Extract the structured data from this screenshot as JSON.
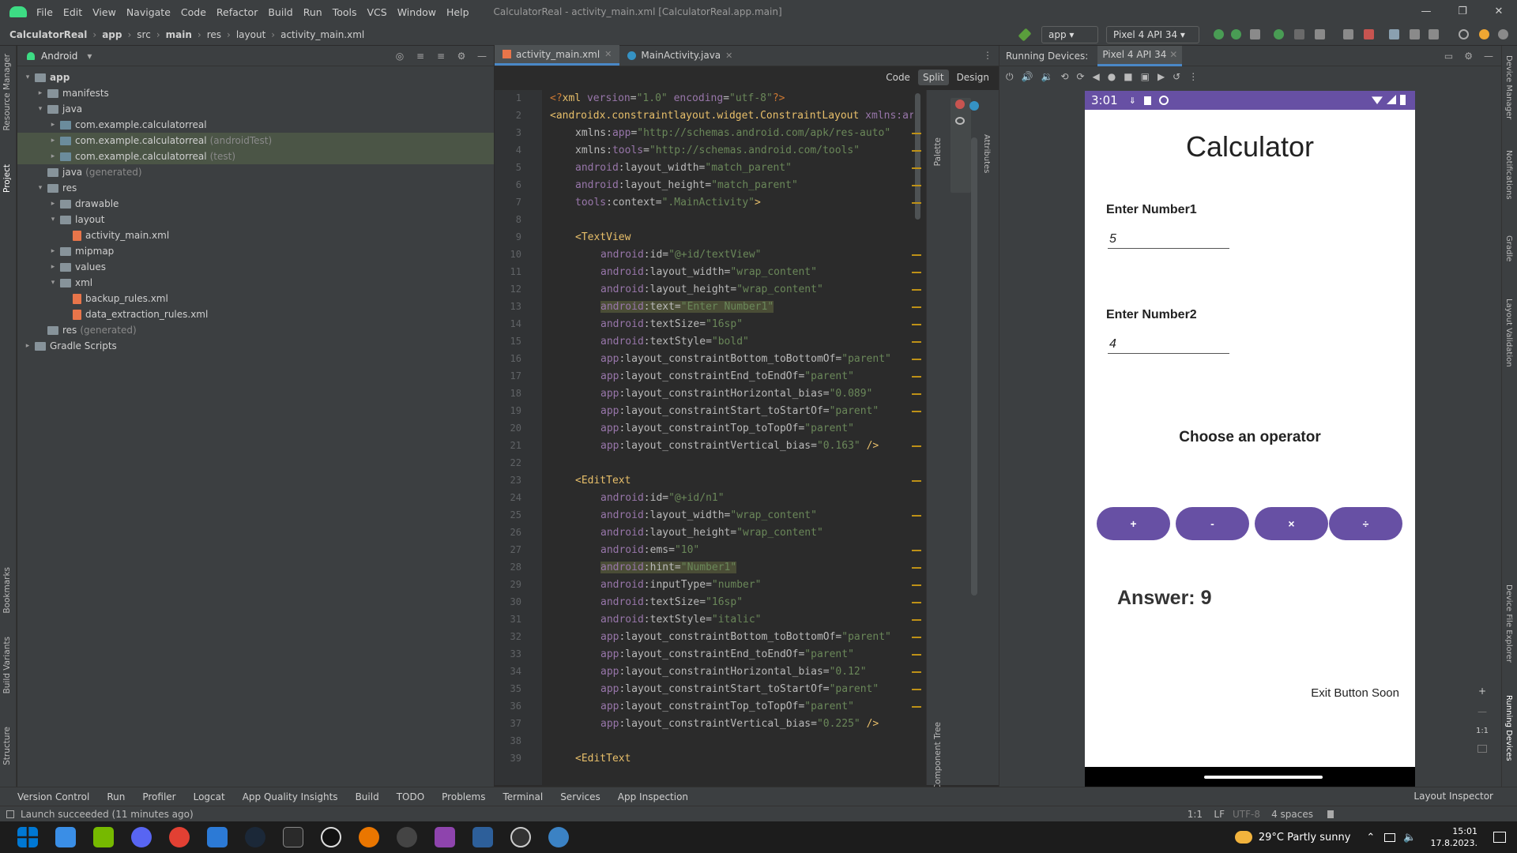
{
  "titlebar": {
    "menu": [
      "File",
      "Edit",
      "View",
      "Navigate",
      "Code",
      "Refactor",
      "Build",
      "Run",
      "Tools",
      "VCS",
      "Window",
      "Help"
    ],
    "window_title": "CalculatorReal - activity_main.xml [CalculatorReal.app.main]",
    "controls": [
      "—",
      "❐",
      "✕"
    ]
  },
  "navbar": {
    "crumbs": [
      "CalculatorReal",
      "app",
      "src",
      "main",
      "res",
      "layout",
      "activity_main.xml"
    ],
    "run_config": "app",
    "device": "Pixel 4 API 34"
  },
  "left_strip": [
    "Resource Manager",
    "Project",
    "Bookmarks",
    "Build Variants",
    "Structure"
  ],
  "right_strip": [
    "Device Manager",
    "Notifications",
    "Gradle",
    "Layout Validation",
    "Device File Explorer",
    "Running Devices"
  ],
  "project": {
    "view_label": "Android",
    "tree": [
      {
        "label": "app",
        "depth": 0,
        "arrow": "▾",
        "kind": "folder",
        "bold": true
      },
      {
        "label": "manifests",
        "depth": 1,
        "arrow": "▸",
        "kind": "folder"
      },
      {
        "label": "java",
        "depth": 1,
        "arrow": "▾",
        "kind": "folder"
      },
      {
        "label": "com.example.calculatorreal",
        "depth": 2,
        "arrow": "▸",
        "kind": "pkg"
      },
      {
        "label": "com.example.calculatorreal",
        "suffix": "(androidTest)",
        "depth": 2,
        "arrow": "▸",
        "kind": "pkg",
        "hl": true
      },
      {
        "label": "com.example.calculatorreal",
        "suffix": "(test)",
        "depth": 2,
        "arrow": "▸",
        "kind": "pkg",
        "hl": true
      },
      {
        "label": "java",
        "suffix": "(generated)",
        "depth": 1,
        "arrow": "",
        "kind": "folder"
      },
      {
        "label": "res",
        "depth": 1,
        "arrow": "▾",
        "kind": "folder"
      },
      {
        "label": "drawable",
        "depth": 2,
        "arrow": "▸",
        "kind": "folder"
      },
      {
        "label": "layout",
        "depth": 2,
        "arrow": "▾",
        "kind": "folder"
      },
      {
        "label": "activity_main.xml",
        "depth": 3,
        "arrow": "",
        "kind": "file"
      },
      {
        "label": "mipmap",
        "depth": 2,
        "arrow": "▸",
        "kind": "folder"
      },
      {
        "label": "values",
        "depth": 2,
        "arrow": "▸",
        "kind": "folder"
      },
      {
        "label": "xml",
        "depth": 2,
        "arrow": "▾",
        "kind": "folder"
      },
      {
        "label": "backup_rules.xml",
        "depth": 3,
        "arrow": "",
        "kind": "file"
      },
      {
        "label": "data_extraction_rules.xml",
        "depth": 3,
        "arrow": "",
        "kind": "file"
      },
      {
        "label": "res",
        "suffix": "(generated)",
        "depth": 1,
        "arrow": "",
        "kind": "folder"
      },
      {
        "label": "Gradle Scripts",
        "depth": 0,
        "arrow": "▸",
        "kind": "folder"
      }
    ]
  },
  "editor": {
    "tabs": [
      {
        "label": "activity_main.xml",
        "active": true
      },
      {
        "label": "MainActivity.java",
        "active": false
      }
    ],
    "modes": [
      "Code",
      "Split",
      "Design"
    ],
    "active_mode": "Split",
    "side_labels": {
      "palette": "Palette",
      "component_tree": "Component Tree",
      "attributes": "Attributes"
    },
    "lines": [
      {
        "n": 1,
        "i": 0,
        "t": [
          [
            "pl",
            "<?"
          ],
          [
            "tag",
            "xml "
          ],
          [
            "an",
            "version"
          ],
          [
            "at",
            "="
          ],
          [
            "av",
            "\"1.0\" "
          ],
          [
            "an",
            "encoding"
          ],
          [
            "at",
            "="
          ],
          [
            "av",
            "\"utf-8\""
          ],
          [
            "pl",
            "?>"
          ]
        ]
      },
      {
        "n": 2,
        "i": 0,
        "t": [
          [
            "tag",
            "<androidx.constraintlayout.widget.ConstraintLayout "
          ],
          [
            "an",
            "xmlns:ar"
          ]
        ]
      },
      {
        "n": 3,
        "i": 1,
        "t": [
          [
            "at",
            "xmlns:"
          ],
          [
            "an",
            "app"
          ],
          [
            "at",
            "="
          ],
          [
            "av",
            "\"http://schemas.android.com/apk/res-auto\""
          ]
        ]
      },
      {
        "n": 4,
        "i": 1,
        "t": [
          [
            "at",
            "xmlns:"
          ],
          [
            "an",
            "tools"
          ],
          [
            "at",
            "="
          ],
          [
            "av",
            "\"http://schemas.android.com/tools\""
          ]
        ]
      },
      {
        "n": 5,
        "i": 1,
        "t": [
          [
            "an",
            "android"
          ],
          [
            "at",
            ":layout_width="
          ],
          [
            "av",
            "\"match_parent\""
          ]
        ]
      },
      {
        "n": 6,
        "i": 1,
        "t": [
          [
            "an",
            "android"
          ],
          [
            "at",
            ":layout_height="
          ],
          [
            "av",
            "\"match_parent\""
          ]
        ]
      },
      {
        "n": 7,
        "i": 1,
        "t": [
          [
            "an",
            "tools"
          ],
          [
            "at",
            ":context="
          ],
          [
            "av",
            "\".MainActivity\""
          ],
          [
            "tag",
            ">"
          ]
        ]
      },
      {
        "n": 8,
        "i": 0,
        "t": []
      },
      {
        "n": 9,
        "i": 1,
        "t": [
          [
            "tag",
            "<TextView"
          ]
        ]
      },
      {
        "n": 10,
        "i": 2,
        "t": [
          [
            "an",
            "android"
          ],
          [
            "at",
            ":id="
          ],
          [
            "av",
            "\"@+id/textView\""
          ]
        ]
      },
      {
        "n": 11,
        "i": 2,
        "t": [
          [
            "an",
            "android"
          ],
          [
            "at",
            ":layout_width="
          ],
          [
            "av",
            "\"wrap_content\""
          ]
        ]
      },
      {
        "n": 12,
        "i": 2,
        "t": [
          [
            "an",
            "android"
          ],
          [
            "at",
            ":layout_height="
          ],
          [
            "av",
            "\"wrap_content\""
          ]
        ]
      },
      {
        "n": 13,
        "i": 2,
        "t": [
          [
            "an",
            "android"
          ],
          [
            "at",
            ":text="
          ],
          [
            "av",
            "\"Enter Number1\""
          ]
        ],
        "mark": true
      },
      {
        "n": 14,
        "i": 2,
        "t": [
          [
            "an",
            "android"
          ],
          [
            "at",
            ":textSize="
          ],
          [
            "av",
            "\"16sp\""
          ]
        ]
      },
      {
        "n": 15,
        "i": 2,
        "t": [
          [
            "an",
            "android"
          ],
          [
            "at",
            ":textStyle="
          ],
          [
            "av",
            "\"bold\""
          ]
        ]
      },
      {
        "n": 16,
        "i": 2,
        "t": [
          [
            "an",
            "app"
          ],
          [
            "at",
            ":layout_constraintBottom_toBottomOf="
          ],
          [
            "av",
            "\"parent\""
          ]
        ]
      },
      {
        "n": 17,
        "i": 2,
        "t": [
          [
            "an",
            "app"
          ],
          [
            "at",
            ":layout_constraintEnd_toEndOf="
          ],
          [
            "av",
            "\"parent\""
          ]
        ]
      },
      {
        "n": 18,
        "i": 2,
        "t": [
          [
            "an",
            "app"
          ],
          [
            "at",
            ":layout_constraintHorizontal_bias="
          ],
          [
            "av",
            "\"0.089\""
          ]
        ]
      },
      {
        "n": 19,
        "i": 2,
        "t": [
          [
            "an",
            "app"
          ],
          [
            "at",
            ":layout_constraintStart_toStartOf="
          ],
          [
            "av",
            "\"parent\""
          ]
        ]
      },
      {
        "n": 20,
        "i": 2,
        "t": [
          [
            "an",
            "app"
          ],
          [
            "at",
            ":layout_constraintTop_toTopOf="
          ],
          [
            "av",
            "\"parent\""
          ]
        ]
      },
      {
        "n": 21,
        "i": 2,
        "t": [
          [
            "an",
            "app"
          ],
          [
            "at",
            ":layout_constraintVertical_bias="
          ],
          [
            "av",
            "\"0.163\" "
          ],
          [
            "tag",
            "/>"
          ]
        ]
      },
      {
        "n": 22,
        "i": 0,
        "t": []
      },
      {
        "n": 23,
        "i": 1,
        "t": [
          [
            "tag",
            "<EditText"
          ]
        ]
      },
      {
        "n": 24,
        "i": 2,
        "t": [
          [
            "an",
            "android"
          ],
          [
            "at",
            ":id="
          ],
          [
            "av",
            "\"@+id/n1\""
          ]
        ]
      },
      {
        "n": 25,
        "i": 2,
        "t": [
          [
            "an",
            "android"
          ],
          [
            "at",
            ":layout_width="
          ],
          [
            "av",
            "\"wrap_content\""
          ]
        ]
      },
      {
        "n": 26,
        "i": 2,
        "t": [
          [
            "an",
            "android"
          ],
          [
            "at",
            ":layout_height="
          ],
          [
            "av",
            "\"wrap_content\""
          ]
        ]
      },
      {
        "n": 27,
        "i": 2,
        "t": [
          [
            "an",
            "android"
          ],
          [
            "at",
            ":ems="
          ],
          [
            "av",
            "\"10\""
          ]
        ]
      },
      {
        "n": 28,
        "i": 2,
        "t": [
          [
            "an",
            "android"
          ],
          [
            "at",
            ":hint="
          ],
          [
            "av",
            "\"Number1\""
          ]
        ],
        "mark": true
      },
      {
        "n": 29,
        "i": 2,
        "t": [
          [
            "an",
            "android"
          ],
          [
            "at",
            ":inputType="
          ],
          [
            "av",
            "\"number\""
          ]
        ]
      },
      {
        "n": 30,
        "i": 2,
        "t": [
          [
            "an",
            "android"
          ],
          [
            "at",
            ":textSize="
          ],
          [
            "av",
            "\"16sp\""
          ]
        ]
      },
      {
        "n": 31,
        "i": 2,
        "t": [
          [
            "an",
            "android"
          ],
          [
            "at",
            ":textStyle="
          ],
          [
            "av",
            "\"italic\""
          ]
        ]
      },
      {
        "n": 32,
        "i": 2,
        "t": [
          [
            "an",
            "app"
          ],
          [
            "at",
            ":layout_constraintBottom_toBottomOf="
          ],
          [
            "av",
            "\"parent\""
          ]
        ]
      },
      {
        "n": 33,
        "i": 2,
        "t": [
          [
            "an",
            "app"
          ],
          [
            "at",
            ":layout_constraintEnd_toEndOf="
          ],
          [
            "av",
            "\"parent\""
          ]
        ]
      },
      {
        "n": 34,
        "i": 2,
        "t": [
          [
            "an",
            "app"
          ],
          [
            "at",
            ":layout_constraintHorizontal_bias="
          ],
          [
            "av",
            "\"0.12\""
          ]
        ]
      },
      {
        "n": 35,
        "i": 2,
        "t": [
          [
            "an",
            "app"
          ],
          [
            "at",
            ":layout_constraintStart_toStartOf="
          ],
          [
            "av",
            "\"parent\""
          ]
        ]
      },
      {
        "n": 36,
        "i": 2,
        "t": [
          [
            "an",
            "app"
          ],
          [
            "at",
            ":layout_constraintTop_toTopOf="
          ],
          [
            "av",
            "\"parent\""
          ]
        ]
      },
      {
        "n": 37,
        "i": 2,
        "t": [
          [
            "an",
            "app"
          ],
          [
            "at",
            ":layout_constraintVertical_bias="
          ],
          [
            "av",
            "\"0.225\" "
          ],
          [
            "tag",
            "/>"
          ]
        ]
      },
      {
        "n": 38,
        "i": 0,
        "t": []
      },
      {
        "n": 39,
        "i": 1,
        "t": [
          [
            "tag",
            "<EditText"
          ]
        ]
      }
    ]
  },
  "devices": {
    "title": "Running Devices:",
    "tab": "Pixel 4 API 34",
    "phone": {
      "time": "3:01",
      "title": "Calculator",
      "label1": "Enter Number1",
      "value1": "5",
      "label2": "Enter Number2",
      "value2": "4",
      "operator_label": "Choose an operator",
      "operators": [
        "+",
        "-",
        "×",
        "÷"
      ],
      "answer": "Answer: 9",
      "exit_text": "Exit Button Soon"
    },
    "zoom_controls": [
      "+",
      "—",
      "1:1"
    ]
  },
  "bottom_tools": [
    "Version Control",
    "Run",
    "Profiler",
    "Logcat",
    "App Quality Insights",
    "Build",
    "TODO",
    "Problems",
    "Terminal",
    "Services",
    "App Inspection"
  ],
  "layout_inspector": "Layout Inspector",
  "status": {
    "message": "Launch succeeded (11 minutes ago)",
    "position": "1:1",
    "line_sep": "LF",
    "encoding": "UTF-8",
    "indent": "4 spaces"
  },
  "taskbar": {
    "weather": "29°C  Partly sunny",
    "time": "15:01",
    "date": "17.8.2023."
  },
  "colors": {
    "accent": "#6750a4",
    "ide_bg": "#2b2b2b",
    "panel": "#3c3f41",
    "android_green": "#3ddc84"
  }
}
